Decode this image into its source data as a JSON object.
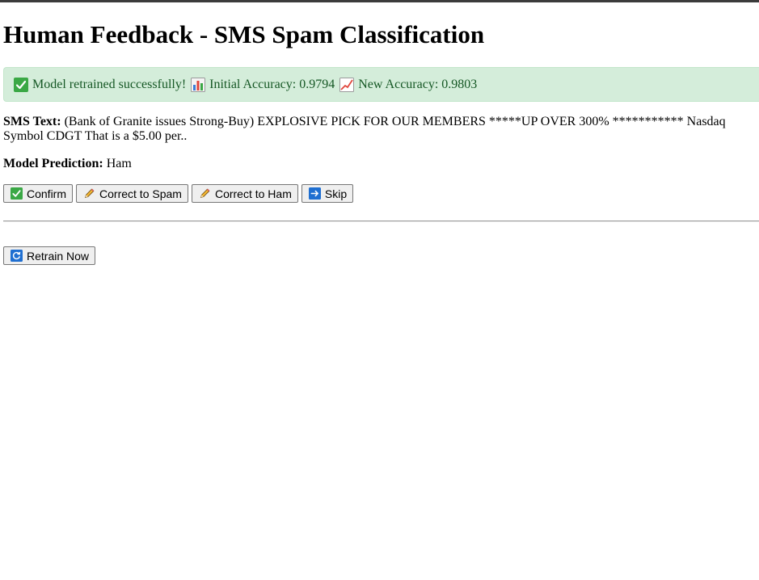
{
  "page": {
    "title": "Human Feedback - SMS Spam Classification"
  },
  "alert": {
    "message": "Model retrained successfully!",
    "initial_accuracy": "Initial Accuracy: 0.9794",
    "new_accuracy": "New Accuracy: 0.9803",
    "icons": [
      "check-mark-icon",
      "bar-chart-icon",
      "trending-up-chart-icon"
    ],
    "colors": {
      "background": "#d4edda",
      "text": "#155724"
    }
  },
  "sms": {
    "label": "SMS Text:",
    "text": "(Bank of Granite issues Strong-Buy) EXPLOSIVE PICK FOR OUR MEMBERS *****UP OVER 300% *********** Nasdaq Symbol CDGT That is a $5.00 per.."
  },
  "prediction": {
    "label": "Model Prediction:",
    "value": "Ham"
  },
  "actions": {
    "confirm": {
      "label": "Confirm",
      "icon": "check-mark-icon"
    },
    "correct_spam": {
      "label": "Correct to Spam",
      "icon": "pencil-icon"
    },
    "correct_ham": {
      "label": "Correct to Ham",
      "icon": "pencil-icon"
    },
    "skip": {
      "label": "Skip",
      "icon": "right-arrow-icon"
    }
  },
  "retrain": {
    "label": "Retrain Now",
    "icon": "refresh-icon"
  }
}
